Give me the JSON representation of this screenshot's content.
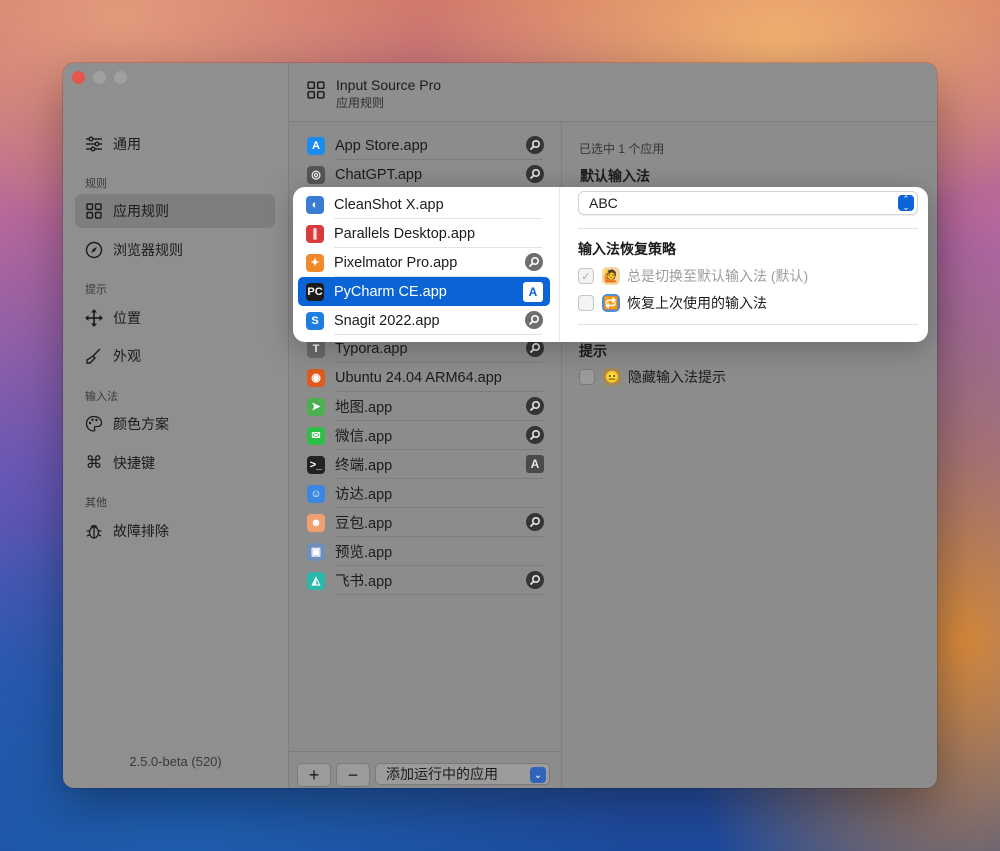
{
  "header": {
    "title": "Input Source Pro",
    "subtitle": "应用规则"
  },
  "sidebar": {
    "items": [
      {
        "label": "通用",
        "icon": "sliders-icon"
      },
      {
        "label": "应用规则",
        "icon": "grid-icon"
      },
      {
        "label": "浏览器规则",
        "icon": "compass-icon"
      },
      {
        "label": "位置",
        "icon": "move-icon"
      },
      {
        "label": "外观",
        "icon": "paintbrush-icon"
      },
      {
        "label": "颜色方案",
        "icon": "palette-icon"
      },
      {
        "label": "快捷键",
        "icon": "command-icon"
      },
      {
        "label": "故障排除",
        "icon": "bug-icon"
      }
    ],
    "sections": [
      "规则",
      "提示",
      "输入法",
      "其他"
    ],
    "version": "2.5.0-beta (520)"
  },
  "apps": [
    {
      "name": "App Store.app",
      "badge": "pin",
      "color": "#1a8cf0",
      "glyph": "A"
    },
    {
      "name": "ChatGPT.app",
      "badge": "pin",
      "color": "#555555",
      "glyph": "◎"
    },
    {
      "name": "CleanShot X.app",
      "badge": "",
      "color": "#3b7bd4",
      "glyph": "◐"
    },
    {
      "name": "Parallels Desktop.app",
      "badge": "",
      "color": "#d93a3a",
      "glyph": "∥"
    },
    {
      "name": "Pixelmator Pro.app",
      "badge": "pin",
      "color": "#f28a2a",
      "glyph": "✦"
    },
    {
      "name": "PyCharm CE.app",
      "badge": "A",
      "color": "#1b1b1b",
      "glyph": "PC"
    },
    {
      "name": "Snagit 2022.app",
      "badge": "pin",
      "color": "#1e7de0",
      "glyph": "S"
    },
    {
      "name": "Typora.app",
      "badge": "pin",
      "color": "#6a6a6a",
      "glyph": "T"
    },
    {
      "name": "Ubuntu 24.04 ARM64.app",
      "badge": "",
      "color": "#e05a1e",
      "glyph": "◉"
    },
    {
      "name": "地图.app",
      "badge": "pin",
      "color": "#4caf50",
      "glyph": "➤"
    },
    {
      "name": "微信.app",
      "badge": "pin",
      "color": "#2bbf45",
      "glyph": "✉"
    },
    {
      "name": "终端.app",
      "badge": "A",
      "color": "#222222",
      "glyph": ">_"
    },
    {
      "name": "访达.app",
      "badge": "",
      "color": "#3a86e0",
      "glyph": "☺"
    },
    {
      "name": "豆包.app",
      "badge": "pin",
      "color": "#f0a070",
      "glyph": "☻"
    },
    {
      "name": "预览.app",
      "badge": "",
      "color": "#6d8fb8",
      "glyph": "▣"
    },
    {
      "name": "飞书.app",
      "badge": "pin",
      "color": "#2ab8a8",
      "glyph": "◭"
    }
  ],
  "bottombar": {
    "add": "+",
    "remove": "−",
    "add_running": "添加运行中的应用"
  },
  "detail": {
    "selected_count": "已选中 1 个应用",
    "default_input_heading": "默认输入法",
    "default_input_value": "ABC",
    "restore_heading": "输入法恢复策略",
    "option_always": "总是切换至默认输入法 (默认)",
    "option_restore": "恢复上次使用的输入法",
    "hint_heading": "提示",
    "option_hide_hint": "隐藏输入法提示"
  },
  "colors": {
    "accent": "#0a64d6",
    "close": "#e6564b"
  }
}
